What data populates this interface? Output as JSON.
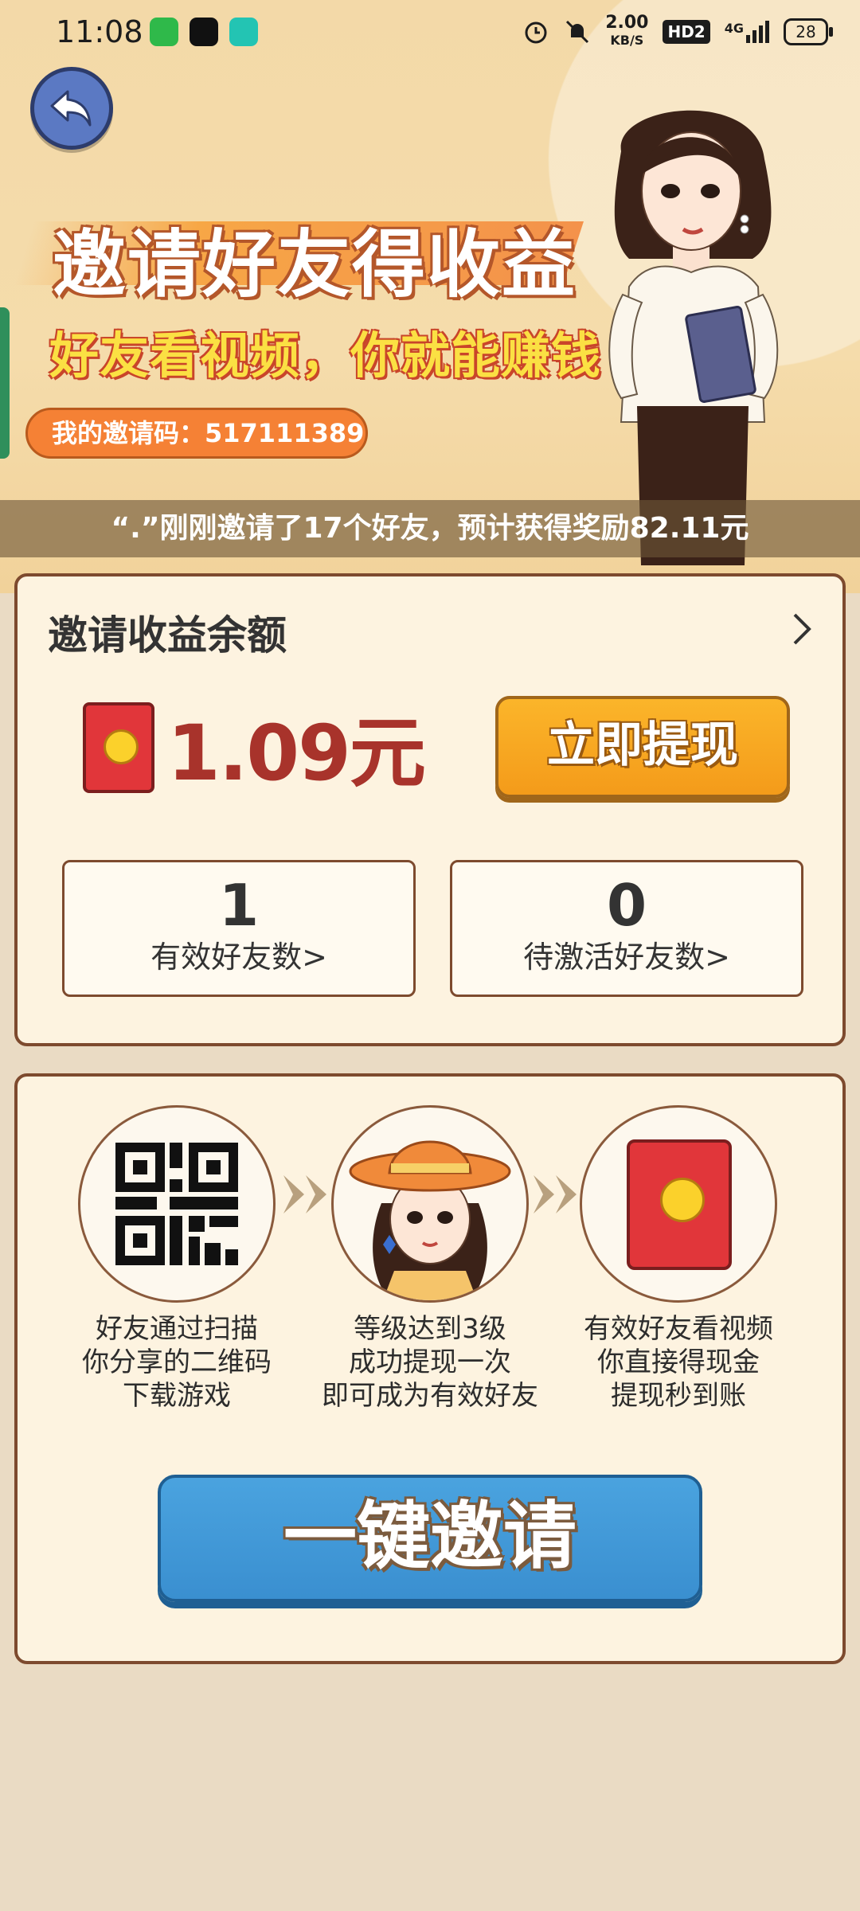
{
  "status_bar": {
    "time": "11:08",
    "net_speed_value": "2.00",
    "net_speed_unit": "KB/S",
    "hd_label": "HD2",
    "signal_label": "4G",
    "battery": "28",
    "app_colors": [
      "#2fb94a",
      "#111111",
      "#23c4b3"
    ]
  },
  "hero": {
    "title": "邀请好友得收益",
    "subtitle": "好友看视频，你就能赚钱",
    "invite_code": "我的邀请码：517111389",
    "ticker": "“.”刚刚邀请了17个好友，预计获得奖励82.11元"
  },
  "balance": {
    "title": "邀请收益余额",
    "amount": "1.09元",
    "withdraw_label": "立即提现",
    "valid_friends_count": "1",
    "valid_friends_label": "有效好友数>",
    "pending_friends_count": "0",
    "pending_friends_label": "待激活好友数>"
  },
  "steps": [
    {
      "icon": "qr-code-icon",
      "lines": [
        "好友通过扫描",
        "你分享的二维码",
        "下载游戏"
      ]
    },
    {
      "icon": "girl-avatar-icon",
      "lines": [
        "等级达到3级",
        "成功提现一次",
        "即可成为有效好友"
      ]
    },
    {
      "icon": "red-envelope-icon",
      "lines": [
        "有效好友看视频",
        "你直接得现金",
        "提现秒到账"
      ]
    }
  ],
  "invite_button": "一键邀请",
  "colors": {
    "accent_orange": "#f7a746",
    "amount_red": "#a8332b",
    "invite_blue": "#3a8fd0",
    "card_border": "#7d4a2e",
    "card_bg": "#fdf3e0"
  }
}
